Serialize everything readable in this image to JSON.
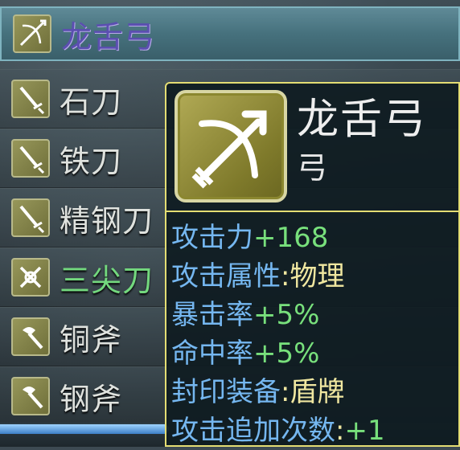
{
  "item_list": [
    {
      "name": "龙舌弓",
      "icon": "bow-icon",
      "selected": true,
      "color": "#5b4fb0"
    },
    {
      "name": "石刀",
      "icon": "sword-icon",
      "selected": false
    },
    {
      "name": "铁刀",
      "icon": "sword-icon",
      "selected": false
    },
    {
      "name": "精钢刀",
      "icon": "sword-icon",
      "selected": false
    },
    {
      "name": "三尖刀",
      "icon": "trident-icon",
      "selected": false,
      "color": "#73d87e"
    },
    {
      "name": "铜斧",
      "icon": "axe-icon",
      "selected": false
    },
    {
      "name": "钢斧",
      "icon": "axe-icon",
      "selected": false
    }
  ],
  "tooltip": {
    "title": "龙舌弓",
    "type": "弓",
    "icon": "bow-icon",
    "border_color": "#e4dd73",
    "stats": [
      {
        "key": "攻击力",
        "value": "+168",
        "value_color": "green"
      },
      {
        "key": "攻击属性",
        "sep": ":",
        "value": "物理",
        "value_color": "yellow"
      },
      {
        "key": "暴击率",
        "value": "+5%",
        "value_color": "green"
      },
      {
        "key": "命中率",
        "value": "+5%",
        "value_color": "green"
      },
      {
        "key": "封印装备",
        "sep": ":",
        "value": "盾牌",
        "value_color": "yellow"
      },
      {
        "key": "攻击追加次数",
        "sep": ":",
        "value": "+1",
        "value_color": "green"
      }
    ]
  }
}
